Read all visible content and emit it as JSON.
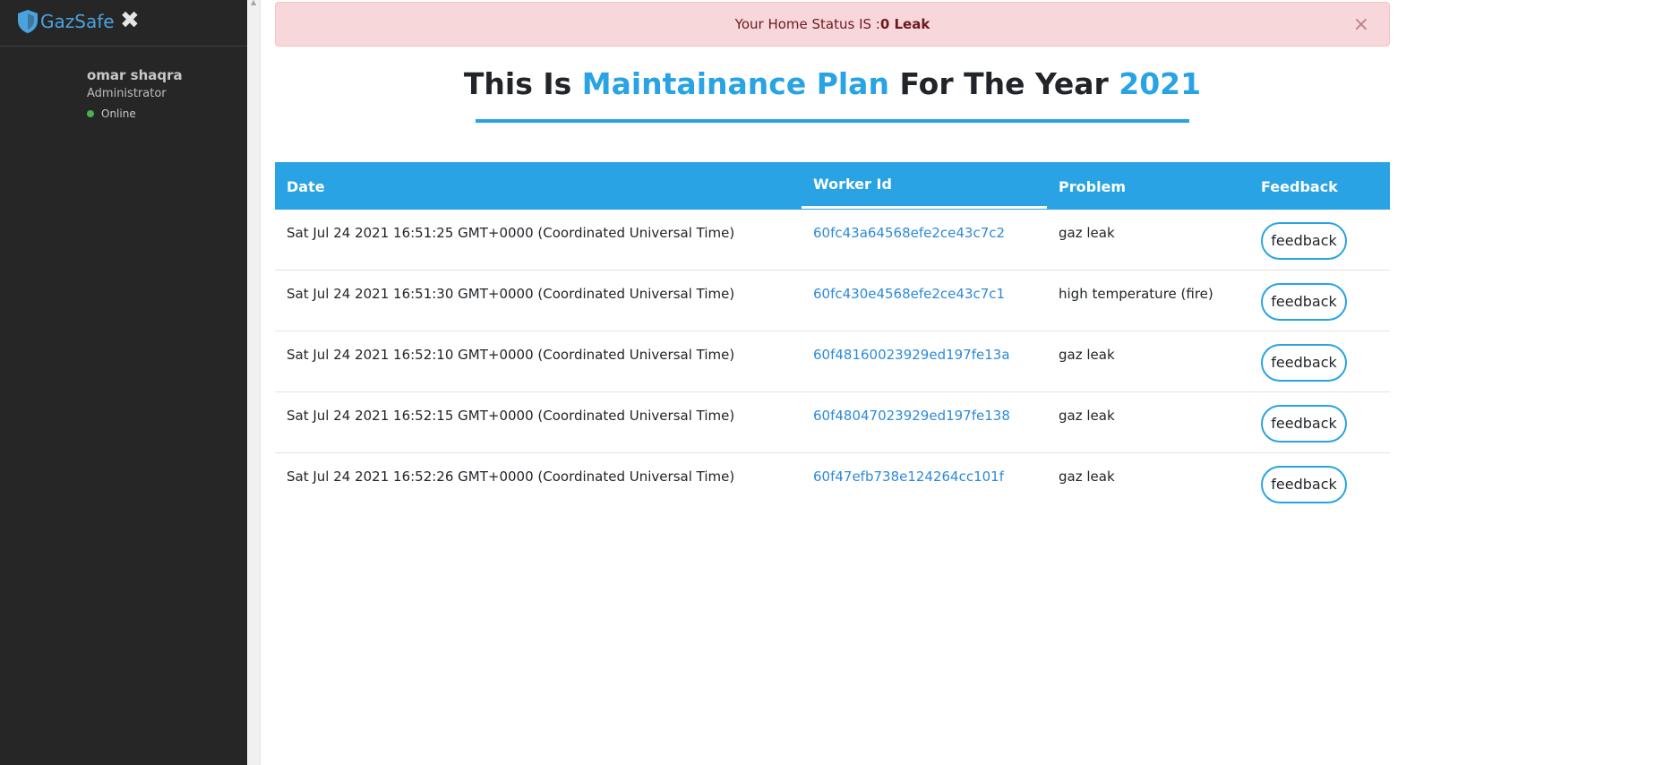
{
  "sidebar": {
    "brand": "GazSafe",
    "close_glyph": "✖",
    "user": {
      "name": "omar shaqra",
      "role": "Administrator",
      "status": "Online"
    },
    "icons": {
      "brand": "shield-icon",
      "close": "close-icon",
      "status": "status-dot-icon"
    }
  },
  "alert": {
    "prefix": "Your Home Status IS :",
    "status": "0 Leak",
    "close_glyph": "×"
  },
  "heading": {
    "part1": "This Is ",
    "accent1": "Maintainance Plan",
    "part2": " For The Year ",
    "accent2": "2021"
  },
  "table": {
    "headers": {
      "date": "Date",
      "worker": "Worker Id",
      "problem": "Problem",
      "feedback": "Feedback"
    },
    "rows": [
      {
        "date": "Sat Jul 24 2021 16:51:25 GMT+0000 (Coordinated Universal Time)",
        "worker": "60fc43a64568efe2ce43c7c2",
        "problem": "gaz leak",
        "action": "feedback"
      },
      {
        "date": "Sat Jul 24 2021 16:51:30 GMT+0000 (Coordinated Universal Time)",
        "worker": "60fc430e4568efe2ce43c7c1",
        "problem": "high temperature (fire)",
        "action": "feedback"
      },
      {
        "date": "Sat Jul 24 2021 16:52:10 GMT+0000 (Coordinated Universal Time)",
        "worker": "60f48160023929ed197fe13a",
        "problem": "gaz leak",
        "action": "feedback"
      },
      {
        "date": "Sat Jul 24 2021 16:52:15 GMT+0000 (Coordinated Universal Time)",
        "worker": "60f48047023929ed197fe138",
        "problem": "gaz leak",
        "action": "feedback"
      },
      {
        "date": "Sat Jul 24 2021 16:52:26 GMT+0000 (Coordinated Universal Time)",
        "worker": "60f47efb738e124264cc101f",
        "problem": "gaz leak",
        "action": "feedback"
      }
    ]
  },
  "colors": {
    "accent": "#29a3e3",
    "sidebar": "#262626",
    "alert_bg": "#f8d7da",
    "online": "#4caf50"
  }
}
